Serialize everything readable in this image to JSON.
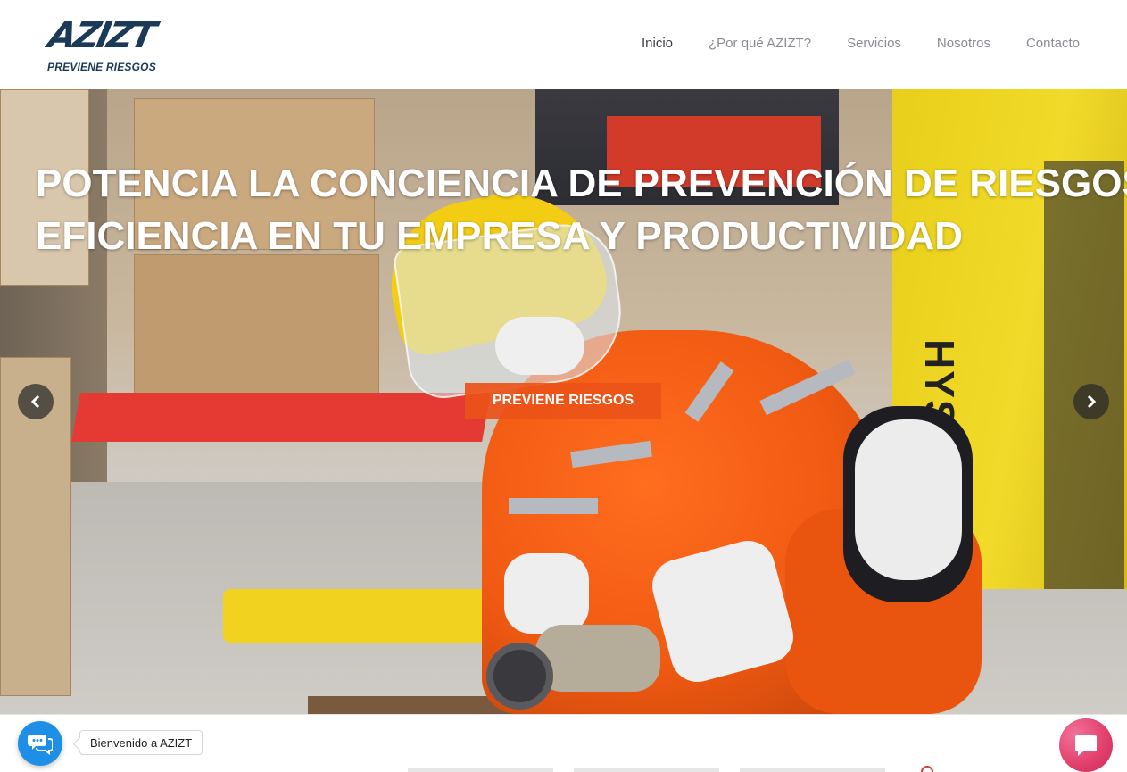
{
  "header": {
    "logo_text": "AZIZT",
    "logo_tagline": "PREVIENE RIESGOS",
    "nav": [
      {
        "label": "Inicio",
        "active": true
      },
      {
        "label": "¿Por qué AZIZT?",
        "active": false
      },
      {
        "label": "Servicios",
        "active": false
      },
      {
        "label": "Nosotros",
        "active": false
      },
      {
        "label": "Contacto",
        "active": false
      }
    ]
  },
  "hero": {
    "headline_line1": "POTENCIA LA CONCIENCIA DE PREVENCIÓN DE RIESGOS,",
    "headline_line2": "EFICIENCIA EN TU EMPRESA Y PRODUCTIVIDAD",
    "cta_label": "PREVIENE RIESGOS",
    "background_text": "HYSTER",
    "prev_icon": "chevron-left-icon",
    "next_icon": "chevron-right-icon"
  },
  "chat": {
    "greeting": "Bienvenido a AZIZT",
    "launcher_icon": "chat-bubbles-icon",
    "messenger_icon": "message-square-icon"
  },
  "colors": {
    "brand_navy": "#1b3a57",
    "cta_orange": "#ec5218",
    "chat_blue": "#1e8fe6",
    "messenger_pink": "#e23e6a"
  }
}
